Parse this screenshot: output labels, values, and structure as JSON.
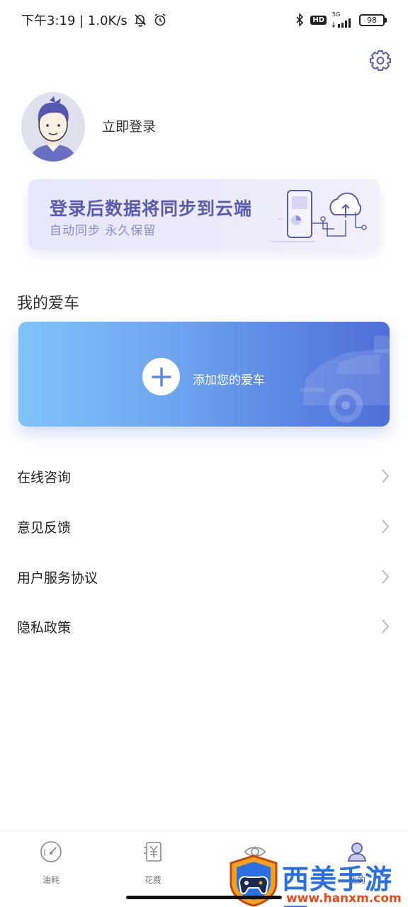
{
  "status_bar": {
    "time_speed": "下午3:19 | 1.0K/s",
    "network": "5G",
    "battery": "98"
  },
  "profile": {
    "login_label": "立即登录"
  },
  "sync_banner": {
    "title": "登录后数据将同步到云端",
    "subtitle": "自动同步 永久保留"
  },
  "my_car": {
    "section_title": "我的爱车",
    "add_label": "添加您的爱车"
  },
  "menu": {
    "items": [
      {
        "label": "在线咨询"
      },
      {
        "label": "意见反馈"
      },
      {
        "label": "用户服务协议"
      },
      {
        "label": "隐私政策"
      }
    ]
  },
  "tabs": {
    "items": [
      {
        "label": "油耗",
        "icon": "gauge-icon"
      },
      {
        "label": "花费",
        "icon": "receipt-yuan-icon"
      },
      {
        "label": "",
        "icon": "eye-icon"
      },
      {
        "label": "我的",
        "icon": "user-icon"
      }
    ],
    "active_color": "#5a5bb0"
  },
  "watermark": {
    "brand": "西美手游网",
    "url": "www.hanxm.com"
  },
  "colors": {
    "accent": "#5a5bb0",
    "banner_bg": "#ebeafa",
    "card_gradient_start": "#7fc3fb",
    "card_gradient_end": "#4f6fd8"
  }
}
